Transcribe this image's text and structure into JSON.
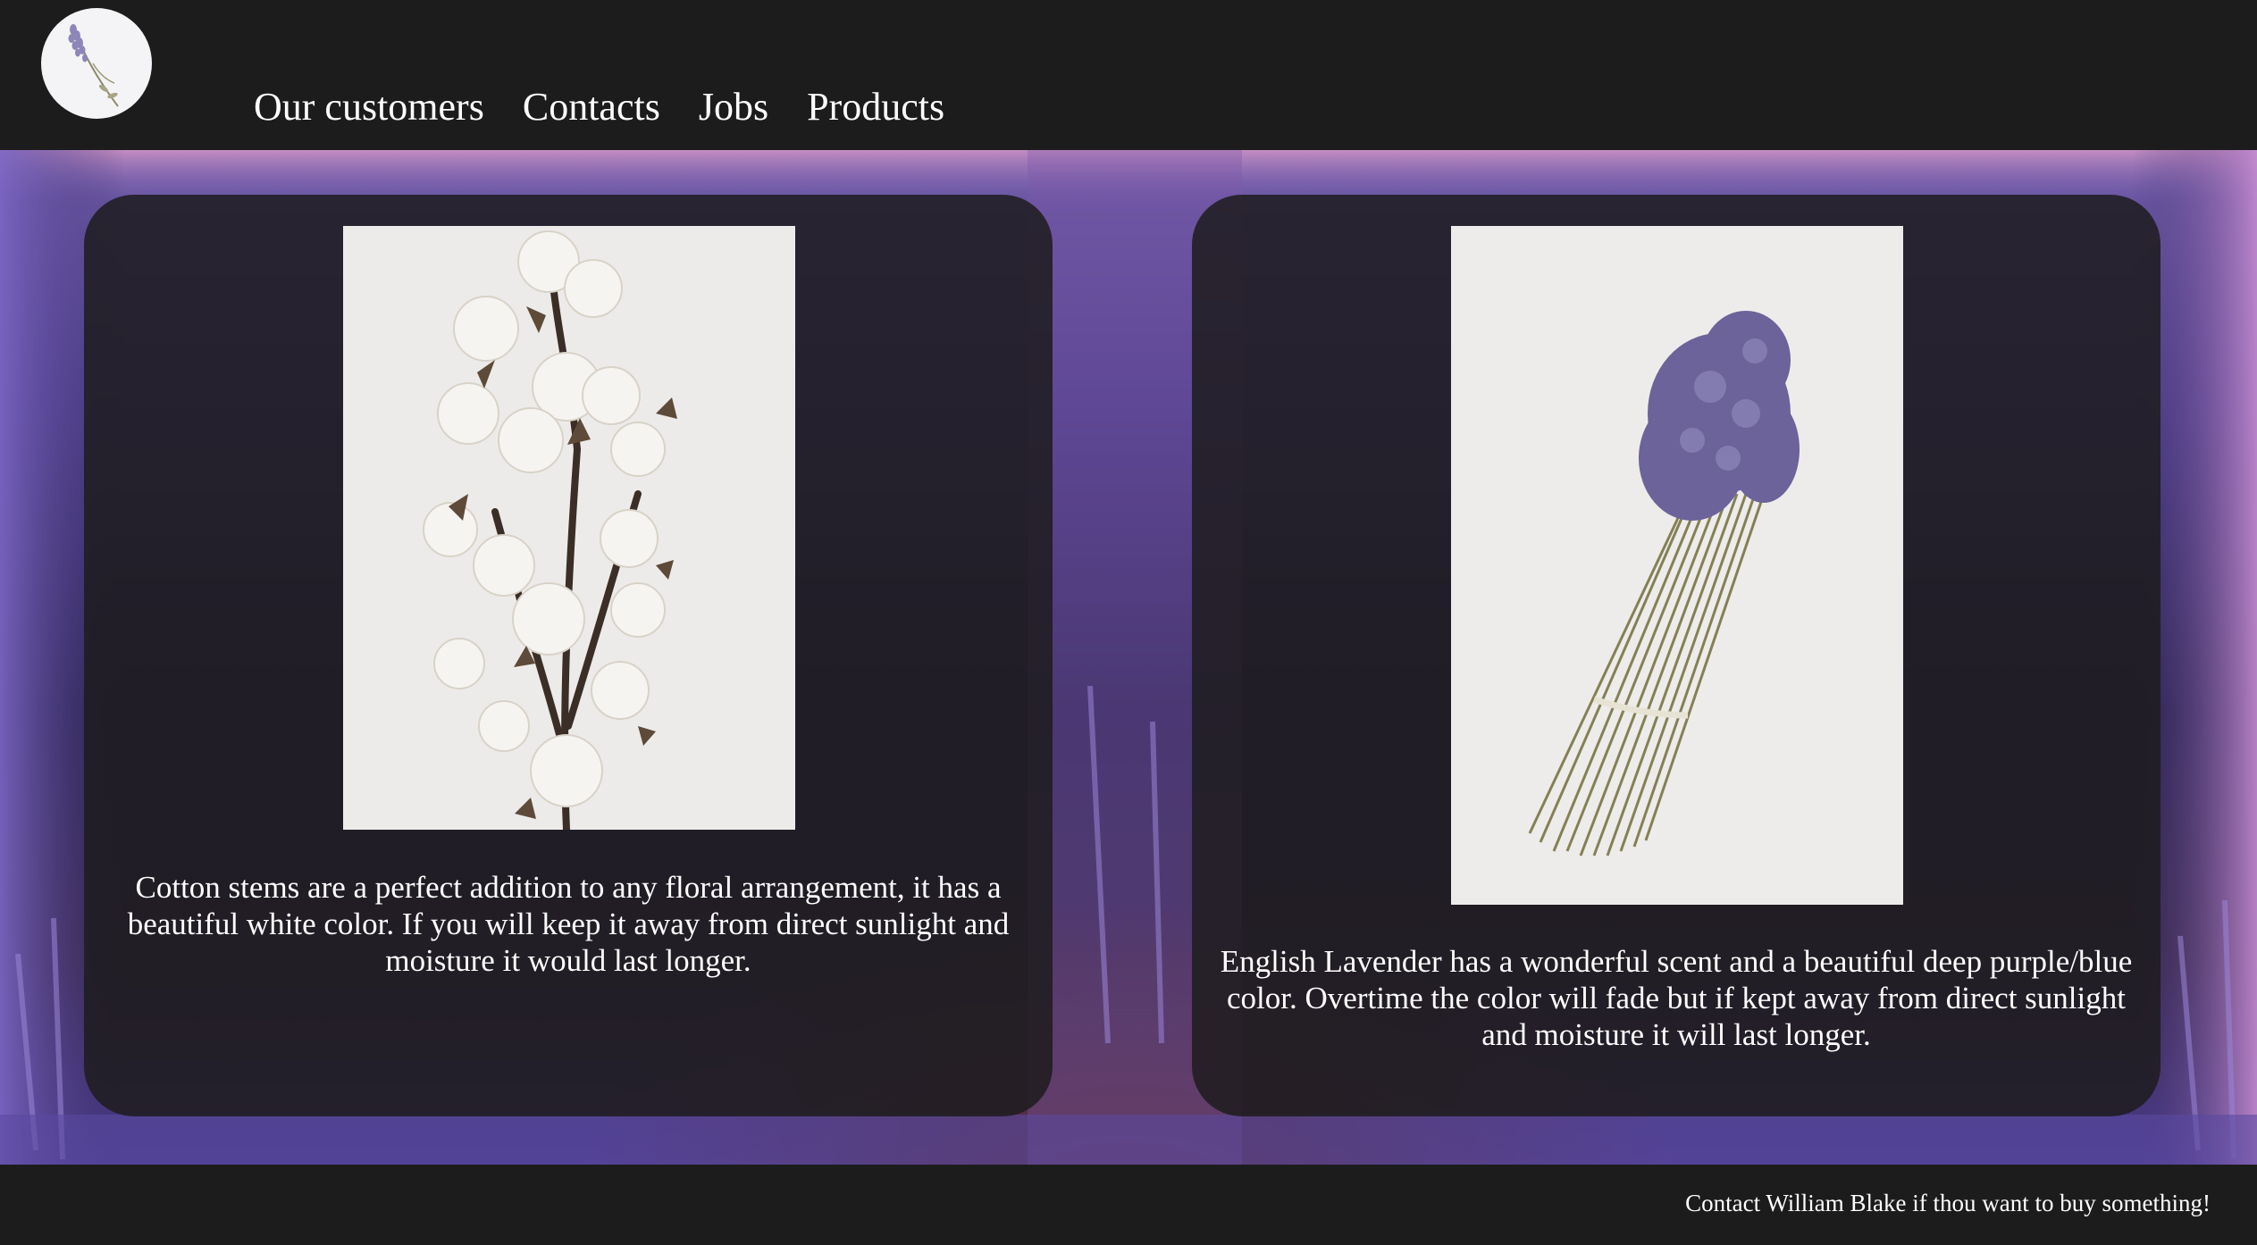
{
  "header": {
    "logo_icon": "lavender-sprig-icon",
    "nav": [
      {
        "label": "Our customers"
      },
      {
        "label": "Contacts"
      },
      {
        "label": "Jobs"
      },
      {
        "label": "Products"
      }
    ]
  },
  "products": [
    {
      "image_icon": "cotton-stems-photo",
      "description": "Cotton stems are a perfect addition to any floral arrangement, it has a beautiful white color. If you will keep it away from direct sunlight and moisture it would last longer."
    },
    {
      "image_icon": "english-lavender-bundle-photo",
      "description": "English Lavender has a wonderful scent and a beautiful deep purple/blue color. Overtime the color will fade but if kept away from direct sunlight and moisture it will last longer."
    }
  ],
  "footer": {
    "text": "Contact William Blake if thou want to buy something!"
  },
  "colors": {
    "bar": "#1c1c1c",
    "card": "rgba(30,28,30,0.86)",
    "lavender": "#6e5aa6",
    "text": "#ffffff"
  }
}
